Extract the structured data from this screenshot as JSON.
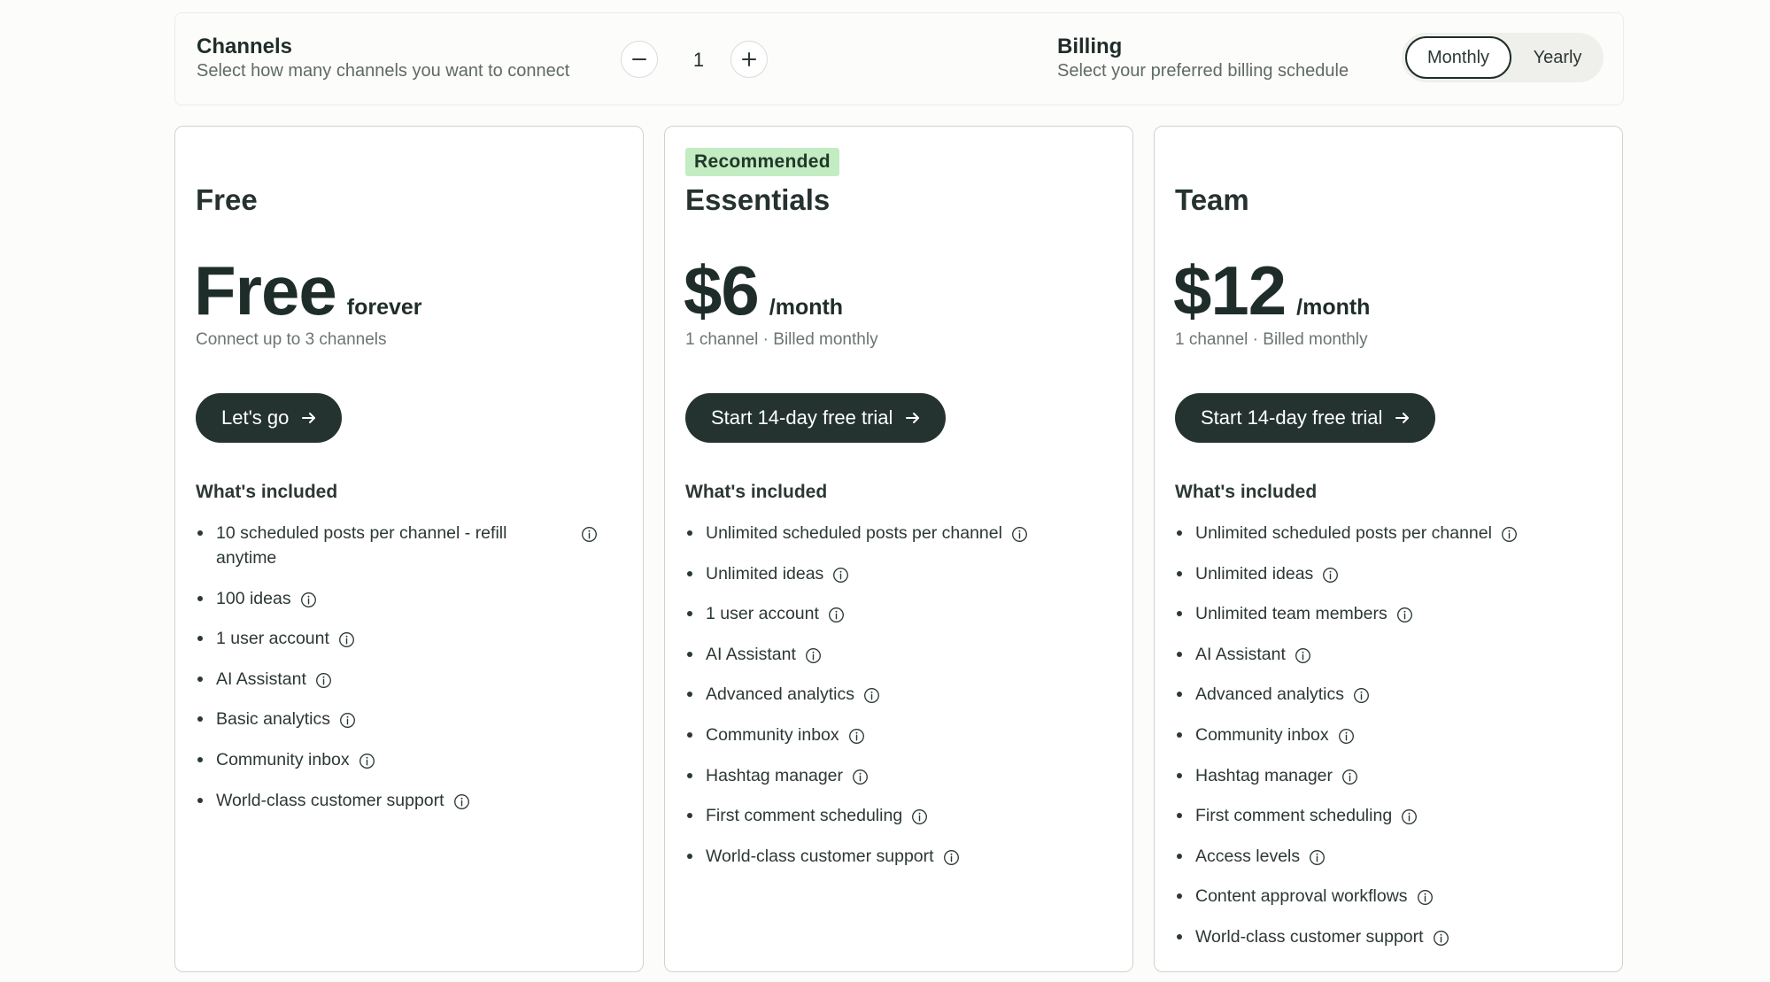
{
  "channels": {
    "title": "Channels",
    "subtitle": "Select how many channels you want to connect",
    "count": "1"
  },
  "billing": {
    "title": "Billing",
    "subtitle": "Select your preferred billing schedule",
    "options": [
      "Monthly",
      "Yearly"
    ],
    "selected": "Monthly"
  },
  "plans": [
    {
      "badge": "",
      "name": "Free",
      "price": "Free",
      "unit": "forever",
      "subtext": "Connect up to 3 channels",
      "cta": "Let's go",
      "included_label": "What's included",
      "features": [
        "10 scheduled posts per channel - refill anytime",
        "100 ideas",
        "1 user account",
        "AI Assistant",
        "Basic analytics",
        "Community inbox",
        "World-class customer support"
      ]
    },
    {
      "badge": "Recommended",
      "name": "Essentials",
      "price": "$6",
      "unit": "/month",
      "subtext": "1 channel · Billed monthly",
      "cta": "Start 14-day free trial",
      "included_label": "What's included",
      "features": [
        "Unlimited scheduled posts per channel",
        "Unlimited ideas",
        "1 user account",
        "AI Assistant",
        "Advanced analytics",
        "Community inbox",
        "Hashtag manager",
        "First comment scheduling",
        "World-class customer support"
      ]
    },
    {
      "badge": "",
      "name": "Team",
      "price": "$12",
      "unit": "/month",
      "subtext": "1 channel · Billed monthly",
      "cta": "Start 14-day free trial",
      "included_label": "What's included",
      "features": [
        "Unlimited scheduled posts per channel",
        "Unlimited ideas",
        "Unlimited team members",
        "AI Assistant",
        "Advanced analytics",
        "Community inbox",
        "Hashtag manager",
        "First comment scheduling",
        "Access levels",
        "Content approval workflows",
        "World-class customer support"
      ]
    }
  ],
  "colors": {
    "primary": "#24332f",
    "badge_bg": "#c3ecc2",
    "border": "#cfd3cf"
  }
}
